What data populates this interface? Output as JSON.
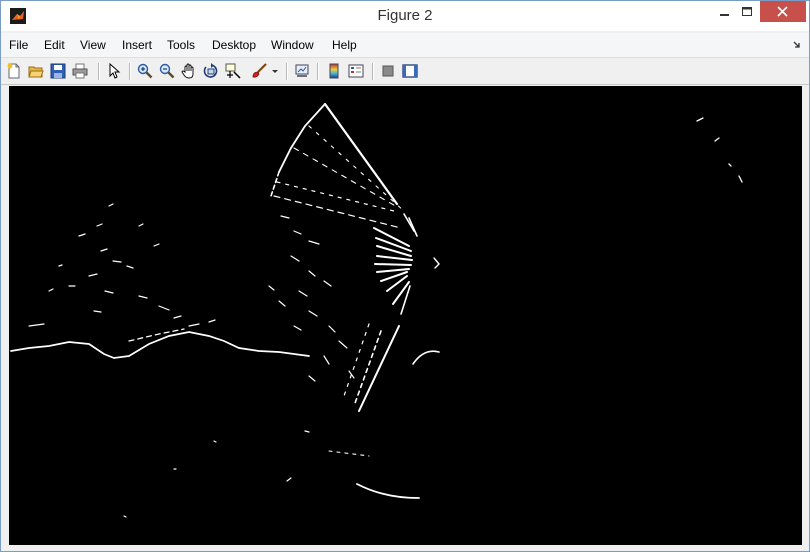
{
  "window": {
    "title": "Figure 2",
    "app_icon": "matlab-logo-icon",
    "controls": [
      "minimize-icon",
      "maximize-icon",
      "close-icon"
    ]
  },
  "menubar": {
    "items": [
      "File",
      "Edit",
      "View",
      "Insert",
      "Tools",
      "Desktop",
      "Window",
      "Help"
    ]
  },
  "toolbar": {
    "buttons": [
      "new-figure-icon",
      "open-file-icon",
      "save-figure-icon",
      "print-figure-icon",
      "edit-plot-arrow-icon",
      "zoom-in-icon",
      "zoom-out-icon",
      "pan-hand-icon",
      "rotate-3d-icon",
      "data-cursor-icon",
      "brush-icon",
      "link-plot-icon",
      "insert-colorbar-icon",
      "insert-legend-icon",
      "hide-plot-tools-icon",
      "show-plot-tools-icon"
    ]
  },
  "figure": {
    "content": "edge-map-image",
    "background": "#000000",
    "foreground": "#ffffff"
  },
  "colors": {
    "title_bar": "#ffffff",
    "close_button": "#c7504a",
    "menubar": "#f5f6f7",
    "toolbar": "#f0f0f0"
  }
}
